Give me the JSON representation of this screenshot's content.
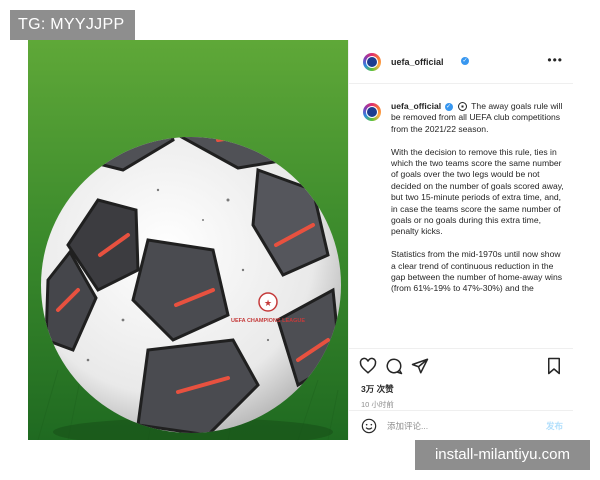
{
  "overlay": {
    "tg_label": "TG: MYYJJPP",
    "site_label": "install-milantiyu.com"
  },
  "post": {
    "username": "uefa_official",
    "verified_mark": "✓",
    "caption_lead": "The away goals rule will be removed from all UEFA club competitions from the 2021/22 season.",
    "caption_paragraph_2": "With the decision to remove this rule, ties in which the two teams score the same number of goals over the two legs would be not decided on the number of goals scored away, but two 15-minute periods of extra time, and, in case the teams score the same number of goals or no goals during this extra time, penalty kicks.",
    "caption_paragraph_3": "Statistics from the mid-1970s until now show a clear trend of continuous reduction in the gap between the number of home-away wins (from 61%-19% to 47%-30%) and the",
    "likes": "3万 次赞",
    "time_ago": "10 小时前",
    "comment_placeholder": "添加评论...",
    "post_button_label": "发布",
    "photo_text": "UEFA CHAMPIONS LEAGUE"
  },
  "icons": {
    "more": "more-icon",
    "like": "heart-icon",
    "comment": "comment-bubble-icon",
    "share": "paper-plane-icon",
    "save": "bookmark-icon",
    "emoji": "smiley-icon"
  },
  "colors": {
    "verified": "#3897f0",
    "post_button": "#b2dffc",
    "grass": "#2f7d2a",
    "overlay_grey": "#8e8e8e"
  }
}
